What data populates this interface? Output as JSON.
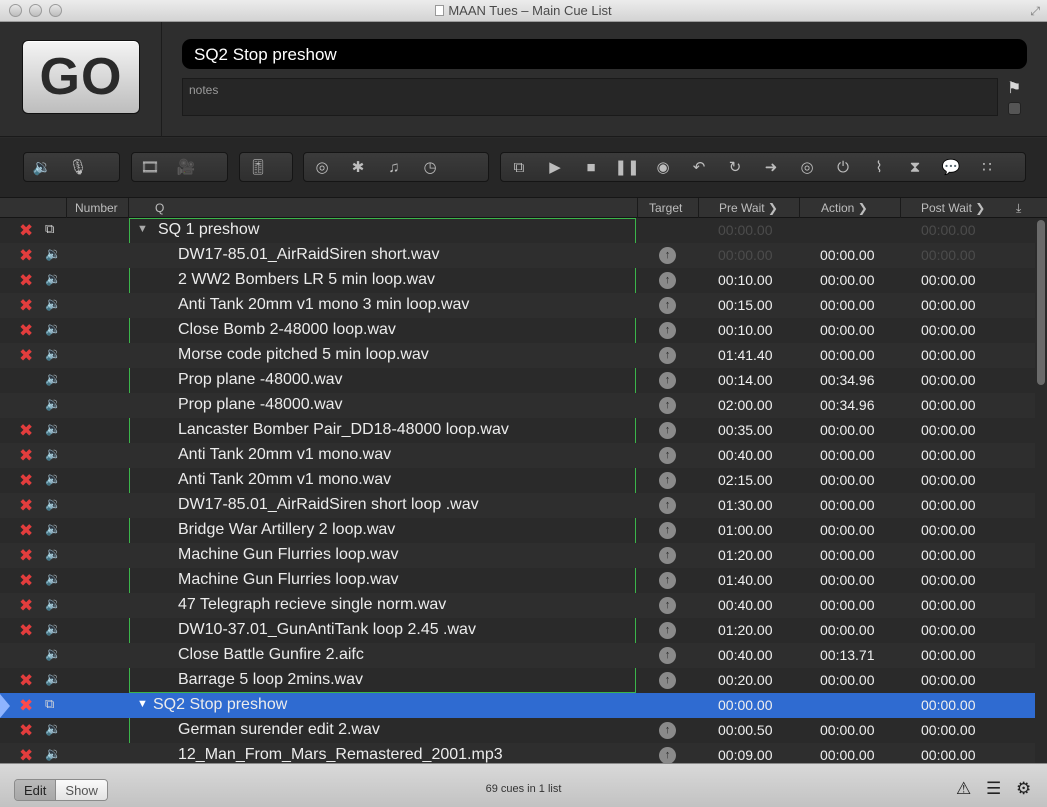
{
  "window": {
    "title": "MAAN Tues – Main Cue List"
  },
  "go_button": {
    "label": "GO"
  },
  "current_cue": {
    "name": "SQ2 Stop preshow",
    "notes_placeholder": "notes"
  },
  "toolbar": {
    "groups": [
      {
        "icons": [
          "🔉",
          "🎙"
        ],
        "names": [
          "audio-cue-icon",
          "mic-cue-icon"
        ]
      },
      {
        "icons": [
          "🎞",
          "🎥"
        ],
        "names": [
          "video-cue-icon",
          "camera-cue-icon"
        ]
      },
      {
        "icons": [
          "🎚"
        ],
        "names": [
          "fade-cue-icon"
        ]
      },
      {
        "icons": [
          "◎",
          "✱",
          "♫",
          "◷"
        ],
        "names": [
          "network-cue-icon",
          "midi-cue-icon",
          "midi-file-cue-icon",
          "timecode-cue-icon"
        ]
      },
      {
        "icons": [
          "⧉",
          "▶",
          "■",
          "❚❚",
          "◉",
          "↶",
          "↻",
          "➜",
          "◎",
          "⏻",
          "⌇",
          "⧗",
          "💬",
          "∷"
        ],
        "names": [
          "group-cue-icon",
          "start-cue-icon",
          "stop-cue-icon",
          "pause-cue-icon",
          "load-cue-icon",
          "reset-cue-icon",
          "goto-cue-icon",
          "target-cue-icon",
          "arm-cue-icon",
          "disarm-cue-icon",
          "devamp-cue-icon",
          "wait-cue-icon",
          "memo-cue-icon",
          "script-cue-icon"
        ]
      }
    ]
  },
  "table": {
    "headers": {
      "number": "Number",
      "q": "Q",
      "target": "Target",
      "pre_wait": "Pre Wait",
      "action": "Action",
      "post_wait": "Post Wait"
    },
    "rows": [
      {
        "broken": true,
        "type": "group",
        "group": true,
        "name": "SQ 1 preshow",
        "target": false,
        "pre": "00:00.00",
        "act": "",
        "post": "00:00.00",
        "dim": true
      },
      {
        "broken": true,
        "type": "audio",
        "name": "DW17-85.01_AirRaidSiren short.wav",
        "target": true,
        "pre": "00:00.00",
        "act": "00:00.00",
        "post": "00:00.00",
        "dim": true,
        "dim_act": true
      },
      {
        "broken": true,
        "type": "audio",
        "name": "2 WW2 Bombers LR 5 min loop.wav",
        "target": true,
        "pre": "00:10.00",
        "act": "00:00.00",
        "post": "00:00.00"
      },
      {
        "broken": true,
        "type": "audio",
        "name": "Anti Tank 20mm v1 mono 3 min loop.wav",
        "target": true,
        "pre": "00:15.00",
        "act": "00:00.00",
        "post": "00:00.00"
      },
      {
        "broken": true,
        "type": "audio",
        "name": "Close Bomb 2-48000 loop.wav",
        "target": true,
        "pre": "00:10.00",
        "act": "00:00.00",
        "post": "00:00.00"
      },
      {
        "broken": true,
        "type": "audio",
        "name": "Morse code pitched 5 min loop.wav",
        "target": true,
        "pre": "01:41.40",
        "act": "00:00.00",
        "post": "00:00.00"
      },
      {
        "broken": false,
        "type": "audio",
        "name": "Prop plane -48000.wav",
        "target": true,
        "pre": "00:14.00",
        "act": "00:34.96",
        "post": "00:00.00"
      },
      {
        "broken": false,
        "type": "audio",
        "name": "Prop plane -48000.wav",
        "target": true,
        "pre": "02:00.00",
        "act": "00:34.96",
        "post": "00:00.00"
      },
      {
        "broken": true,
        "type": "audio",
        "name": "Lancaster Bomber Pair_DD18-48000 loop.wav",
        "target": true,
        "pre": "00:35.00",
        "act": "00:00.00",
        "post": "00:00.00"
      },
      {
        "broken": true,
        "type": "audio",
        "name": "Anti Tank 20mm v1 mono.wav",
        "target": true,
        "pre": "00:40.00",
        "act": "00:00.00",
        "post": "00:00.00"
      },
      {
        "broken": true,
        "type": "audio",
        "name": "Anti Tank 20mm v1 mono.wav",
        "target": true,
        "pre": "02:15.00",
        "act": "00:00.00",
        "post": "00:00.00"
      },
      {
        "broken": true,
        "type": "audio",
        "name": "DW17-85.01_AirRaidSiren short loop .wav",
        "target": true,
        "pre": "01:30.00",
        "act": "00:00.00",
        "post": "00:00.00"
      },
      {
        "broken": true,
        "type": "audio",
        "name": "Bridge War Artillery 2 loop.wav",
        "target": true,
        "pre": "01:00.00",
        "act": "00:00.00",
        "post": "00:00.00"
      },
      {
        "broken": true,
        "type": "audio",
        "name": "Machine Gun Flurries loop.wav",
        "target": true,
        "pre": "01:20.00",
        "act": "00:00.00",
        "post": "00:00.00"
      },
      {
        "broken": true,
        "type": "audio",
        "name": "Machine Gun Flurries loop.wav",
        "target": true,
        "pre": "01:40.00",
        "act": "00:00.00",
        "post": "00:00.00"
      },
      {
        "broken": true,
        "type": "audio",
        "name": "47 Telegraph recieve single norm.wav",
        "target": true,
        "pre": "00:40.00",
        "act": "00:00.00",
        "post": "00:00.00"
      },
      {
        "broken": true,
        "type": "audio",
        "name": "DW10-37.01_GunAntiTank loop 2.45 .wav",
        "target": true,
        "pre": "01:20.00",
        "act": "00:00.00",
        "post": "00:00.00"
      },
      {
        "broken": false,
        "type": "audio",
        "name": "Close Battle Gunfire 2.aifc",
        "target": true,
        "pre": "00:40.00",
        "act": "00:13.71",
        "post": "00:00.00"
      },
      {
        "broken": true,
        "type": "audio",
        "name": "Barrage 5 loop 2mins.wav",
        "target": true,
        "pre": "00:20.00",
        "act": "00:00.00",
        "post": "00:00.00"
      },
      {
        "broken": true,
        "type": "group",
        "group": true,
        "selected": true,
        "name": "SQ2 Stop preshow",
        "target": false,
        "pre": "00:00.00",
        "act": "",
        "post": "00:00.00"
      },
      {
        "broken": true,
        "type": "audio",
        "name": "German surender edit 2.wav",
        "target": true,
        "pre": "00:00.50",
        "act": "00:00.00",
        "post": "00:00.00"
      },
      {
        "broken": true,
        "type": "audio",
        "name": "12_Man_From_Mars_Remastered_2001.mp3",
        "target": true,
        "pre": "00:09.00",
        "act": "00:00.00",
        "post": "00:00.00"
      }
    ]
  },
  "footer": {
    "edit_label": "Edit",
    "show_label": "Show",
    "cue_count": "69 cues in 1 list"
  }
}
